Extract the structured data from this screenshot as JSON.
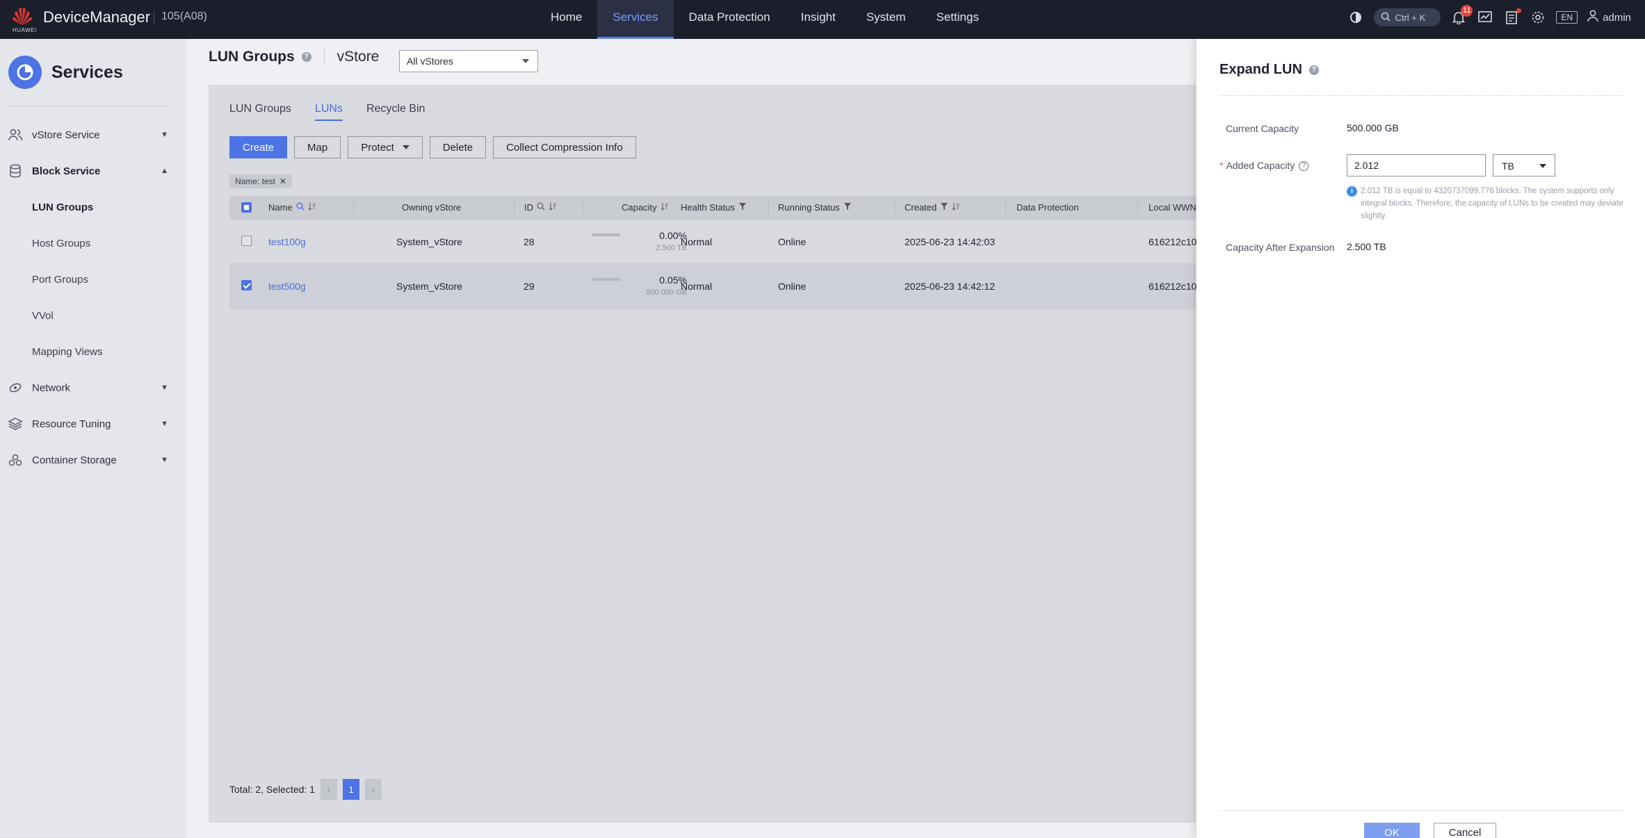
{
  "topbar": {
    "logo_text": "HUAWEI",
    "app_name": "DeviceManager",
    "device_id": "105(A08)",
    "nav": [
      "Home",
      "Services",
      "Data Protection",
      "Insight",
      "System",
      "Settings"
    ],
    "active_nav": "Services",
    "search_shortcut": "Ctrl + K",
    "notification_count": "11",
    "language": "EN",
    "user": "admin"
  },
  "sidebar": {
    "title": "Services",
    "sections": [
      {
        "label": "vStore Service",
        "icon": "users-icon"
      },
      {
        "label": "Block Service",
        "icon": "database-icon"
      },
      {
        "label": "Network",
        "icon": "network-icon"
      },
      {
        "label": "Resource Tuning",
        "icon": "layers-icon"
      },
      {
        "label": "Container Storage",
        "icon": "container-icon"
      }
    ],
    "block_items": [
      "LUN Groups",
      "Host Groups",
      "Port Groups",
      "VVol",
      "Mapping Views"
    ],
    "active_item": "LUN Groups"
  },
  "main": {
    "title": "LUN Groups",
    "vstore_label": "vStore",
    "vstore_select": "All vStores",
    "tabs": [
      "LUN Groups",
      "LUNs",
      "Recycle Bin"
    ],
    "active_tab": "LUNs",
    "toolbar": {
      "create": "Create",
      "map": "Map",
      "protect": "Protect",
      "delete": "Delete",
      "collect": "Collect Compression Info"
    },
    "filter_chip": "Name: test",
    "columns": [
      "Name",
      "Owning vStore",
      "ID",
      "Capacity",
      "Health Status",
      "Running Status",
      "Created",
      "Data Protection",
      "Local WWN"
    ],
    "rows": [
      {
        "name": "test100g",
        "vstore": "System_vStore",
        "id": "28",
        "cap_pct": "0.00%",
        "cap_total": "2.500 TB",
        "usage": 0.0,
        "health": "Normal",
        "running": "Online",
        "created": "2025-06-23 14:42:03",
        "protection": "",
        "wwn": "616212c10",
        "selected": false
      },
      {
        "name": "test500g",
        "vstore": "System_vStore",
        "id": "29",
        "cap_pct": "0.05%",
        "cap_total": "500.000 GB",
        "usage": 0.05,
        "health": "Normal",
        "running": "Online",
        "created": "2025-06-23 14:42:12",
        "protection": "",
        "wwn": "616212c10",
        "selected": true
      }
    ],
    "pager": {
      "summary": "Total: 2, Selected: 1",
      "page": "1"
    }
  },
  "drawer": {
    "title": "Expand LUN",
    "current_capacity_label": "Current Capacity",
    "current_capacity": "500.000 GB",
    "added_capacity_label": "Added Capacity",
    "added_capacity_value": "2.012",
    "unit": "TB",
    "info": "2.012 TB is equal to 4320737099.776 blocks. The system supports only integral blocks. Therefore, the capacity of LUNs to be created may deviate slightly.",
    "after_label": "Capacity After Expansion",
    "after_value": "2.500 TB",
    "ok": "OK",
    "cancel": "Cancel"
  },
  "colors": {
    "accent": "#4d73e4",
    "topbar": "#1b1f2c",
    "badge": "#e5443b"
  }
}
